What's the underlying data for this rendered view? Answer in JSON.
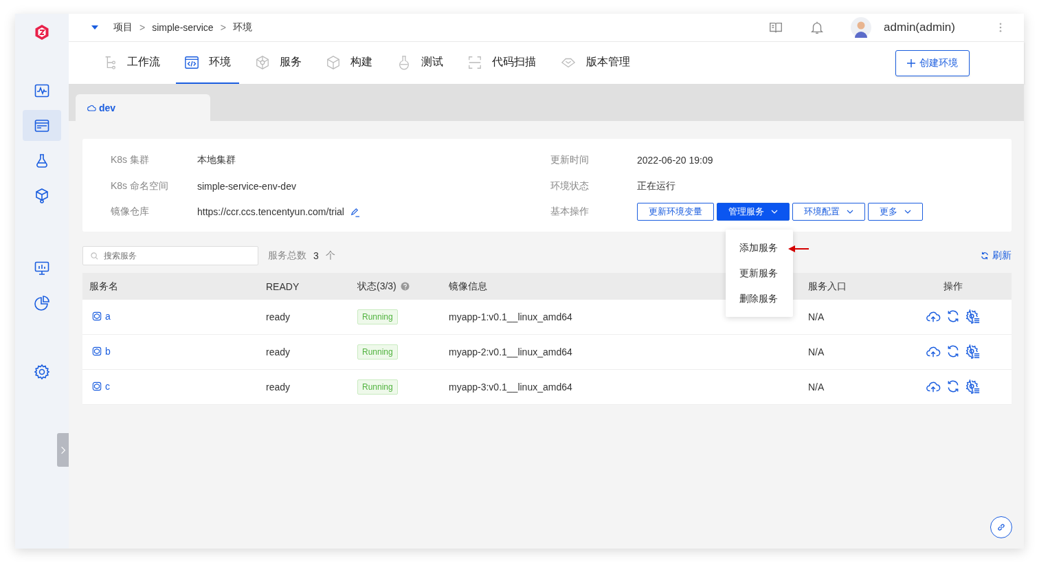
{
  "breadcrumb": [
    "项目",
    "simple-service",
    "环境"
  ],
  "breadcrumb_separator": ">",
  "user": {
    "name": "admin(admin)"
  },
  "sidebar": {
    "groups": [
      [
        {
          "kind": "pulse",
          "selected": false
        },
        {
          "kind": "pm",
          "selected": true
        },
        {
          "kind": "flask",
          "selected": false
        },
        {
          "kind": "cube",
          "selected": false
        }
      ],
      [
        {
          "kind": "monitor",
          "selected": false
        },
        {
          "kind": "pie",
          "selected": false
        }
      ],
      [
        {
          "kind": "gear",
          "selected": false
        }
      ]
    ]
  },
  "tabs": [
    {
      "label": "工作流",
      "kind": "workflow",
      "selected": false
    },
    {
      "label": "环境",
      "kind": "code",
      "selected": true
    },
    {
      "label": "服务",
      "kind": "service",
      "selected": false
    },
    {
      "label": "构建",
      "kind": "build",
      "selected": false
    },
    {
      "label": "测试",
      "kind": "flask",
      "selected": false
    },
    {
      "label": "代码扫描",
      "kind": "scan",
      "selected": false
    },
    {
      "label": "版本管理",
      "kind": "version",
      "selected": false
    }
  ],
  "create_button": {
    "label": "创建环境"
  },
  "env_tabs": [
    {
      "label": "dev",
      "selected": true
    }
  ],
  "info_left": [
    {
      "label": "K8s 集群",
      "value": "本地集群",
      "editable": false
    },
    {
      "label": "K8s 命名空间",
      "value": "simple-service-env-dev",
      "editable": false
    },
    {
      "label": "镜像仓库",
      "value": "https://ccr.ccs.tencentyun.com/trial",
      "editable": true
    }
  ],
  "info_right": [
    {
      "label": "更新时间",
      "value": "2022-06-20 19:09"
    },
    {
      "label": "环境状态",
      "value": "正在运行"
    },
    {
      "label": "基本操作"
    }
  ],
  "actions": [
    {
      "label": "更新环境变量",
      "primary": false,
      "dropdown": false
    },
    {
      "label": "管理服务",
      "primary": true,
      "dropdown": true
    },
    {
      "label": "环境配置",
      "primary": false,
      "dropdown": true
    },
    {
      "label": "更多",
      "primary": false,
      "dropdown": true
    }
  ],
  "dropdown_menu": [
    "添加服务",
    "更新服务",
    "删除服务"
  ],
  "search": {
    "placeholder": "搜索服务"
  },
  "count": {
    "label": "服务总数",
    "value": "3",
    "unit": "个"
  },
  "refresh": "刷新",
  "table": {
    "columns": [
      "服务名",
      "READY",
      "状态(3/3)",
      "镜像信息",
      "服务入口",
      "操作"
    ],
    "rows": [
      {
        "name": "a",
        "ready": "ready",
        "status": "Running",
        "image": "myapp-1:v0.1__linux_amd64",
        "entry": "N/A"
      },
      {
        "name": "b",
        "ready": "ready",
        "status": "Running",
        "image": "myapp-2:v0.1__linux_amd64",
        "entry": "N/A"
      },
      {
        "name": "c",
        "ready": "ready",
        "status": "Running",
        "image": "myapp-3:v0.1__linux_amd64",
        "entry": "N/A"
      }
    ]
  }
}
